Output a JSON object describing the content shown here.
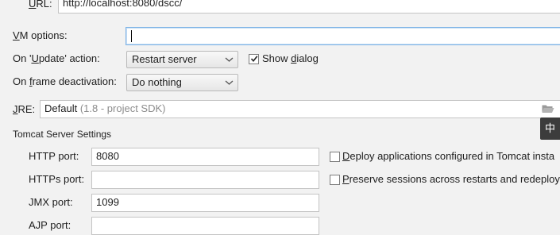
{
  "url": {
    "label_u": "U",
    "label_rest": "RL:",
    "value": "http://localhost:8080/dscc/"
  },
  "vm_options": {
    "label_u": "V",
    "label_rest": "M options:",
    "value": ""
  },
  "on_update": {
    "label_pre": "On '",
    "label_u": "U",
    "label_post": "pdate' action:",
    "value": "Restart server",
    "show_dialog": {
      "pre": "Show ",
      "u": "d",
      "post": "ialog",
      "checked": true
    }
  },
  "on_frame": {
    "label_pre": "On ",
    "label_u": "f",
    "label_post": "rame deactivation:",
    "value": "Do nothing"
  },
  "jre": {
    "label_u": "J",
    "label_rest": "RE:",
    "value_main": "Default",
    "value_hint": "(1.8 - project SDK)"
  },
  "tomcat": {
    "section_title": "Tomcat Server Settings",
    "http_port": {
      "label": "HTTP port:",
      "value": "8080"
    },
    "https_port": {
      "label": "HTTPs port:",
      "value": ""
    },
    "jmx_port": {
      "label": "JMX port:",
      "value": "1099"
    },
    "ajp_port": {
      "label": "AJP port:",
      "value": ""
    },
    "deploy": {
      "u": "D",
      "rest": "eploy applications configured in Tomcat insta",
      "checked": false
    },
    "preserve": {
      "u": "P",
      "rest": "reserve sessions across restarts and redeploy",
      "checked": false
    }
  },
  "ime_indicator": "中",
  "icons": {
    "jre_browse": "folder-icon",
    "combo_arrow": "chevron-down-icon",
    "check": "checkmark-icon"
  },
  "colors": {
    "focus_border": "#7fb4e6",
    "ime_bg": "#3c3c3c",
    "background": "#f2f2f2"
  }
}
